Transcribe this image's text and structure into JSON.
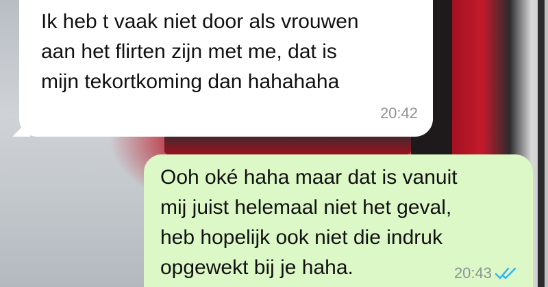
{
  "chat": {
    "messages": [
      {
        "direction": "incoming",
        "text": "Ik heb t vaak niet door als vrouwen\naan het flirten zijn met me, dat is\nmijn tekortkoming dan hahahaha",
        "time": "20:42"
      },
      {
        "direction": "outgoing",
        "text": "Ooh oké haha maar dat is vanuit\nmij juist helemaal niet het geval,\nheb hopelijk ook niet die indruk\nopgewekt bij je haha.",
        "time": "20:43",
        "status_icon": "double-check-read-icon"
      }
    ]
  },
  "colors": {
    "incoming_bubble": "#ffffff",
    "outgoing_bubble": "#dcf8c6",
    "read_ticks": "#34b7f1",
    "timestamp": "#8d9196"
  }
}
